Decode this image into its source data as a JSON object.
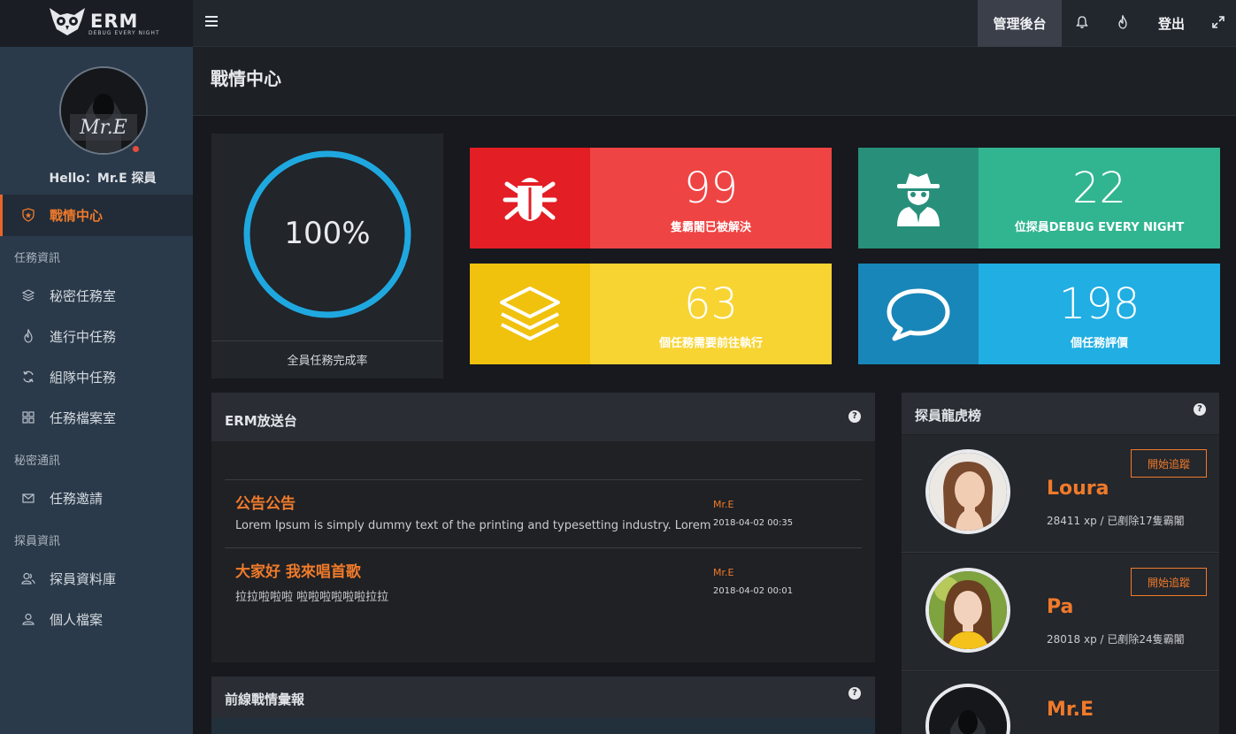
{
  "brand": {
    "name": "ERM",
    "tagline": "DEBUG EVERY NIGHT"
  },
  "topnav": {
    "admin_label": "管理後台",
    "logout_label": "登出",
    "icons": [
      "menu-icon",
      "bell-icon",
      "fire-icon",
      "expand-icon"
    ]
  },
  "sidebar": {
    "greeting": "Hello：Mr.E 探員",
    "avatar_text": "Mr.E",
    "items": [
      {
        "label": "戰情中心",
        "icon": "shield-icon",
        "active": true
      },
      {
        "section": "任務資訊"
      },
      {
        "label": "秘密任務室",
        "icon": "layers-icon"
      },
      {
        "label": "進行中任務",
        "icon": "fire-icon"
      },
      {
        "label": "組隊中任務",
        "icon": "refresh-icon"
      },
      {
        "label": "任務檔案室",
        "icon": "grid-icon"
      },
      {
        "section": "秘密通訊"
      },
      {
        "label": "任務邀請",
        "icon": "mail-icon"
      },
      {
        "section": "探員資訊"
      },
      {
        "label": "探員資料庫",
        "icon": "users-icon"
      },
      {
        "label": "個人檔案",
        "icon": "user-icon"
      }
    ]
  },
  "page": {
    "title": "戰情中心"
  },
  "progress": {
    "value_text": "100%",
    "value": 1.0,
    "label": "全員任務完成率",
    "color": "#1fa8e0"
  },
  "stats": [
    {
      "value": "99",
      "caption": "隻霸闍已被解決",
      "icon": "bug-icon",
      "dark": "#e31e24",
      "light": "#ef4444"
    },
    {
      "value": "22",
      "caption": "位探員DEBUG EVERY NIGHT",
      "icon": "spy-icon",
      "dark": "#28907a",
      "light": "#31b591"
    },
    {
      "value": "63",
      "caption": "個任務需要前往執行",
      "icon": "layers-icon",
      "dark": "#f0c20e",
      "light": "#f8d433"
    },
    {
      "value": "198",
      "caption": "個任務評價",
      "icon": "comment-icon",
      "dark": "#1886b8",
      "light": "#20aee3"
    }
  ],
  "broadcast": {
    "title": "ERM放送台",
    "posts": [
      {
        "title": "公告公告",
        "body": "Lorem Ipsum is simply dummy text of the printing and typesetting industry. Lorem",
        "author": "Mr.E",
        "time": "2018-04-02 00:35"
      },
      {
        "title": "大家好 我來唱首歌",
        "body": "拉拉啦啦啦 啦啦啦啦啦啦拉拉",
        "author": "Mr.E",
        "time": "2018-04-02 00:01"
      }
    ]
  },
  "leaderboard": {
    "title": "探員龍虎榜",
    "follow_label": "開始追蹤",
    "agents": [
      {
        "name": "Loura",
        "stats": "28411 xp / 已剷除17隻霸闍"
      },
      {
        "name": "Pa",
        "stats": "28018 xp / 已剷除24隻霸闍"
      },
      {
        "name": "Mr.E",
        "stats": ""
      }
    ]
  },
  "frontline": {
    "title": "前線戰情彙報"
  }
}
